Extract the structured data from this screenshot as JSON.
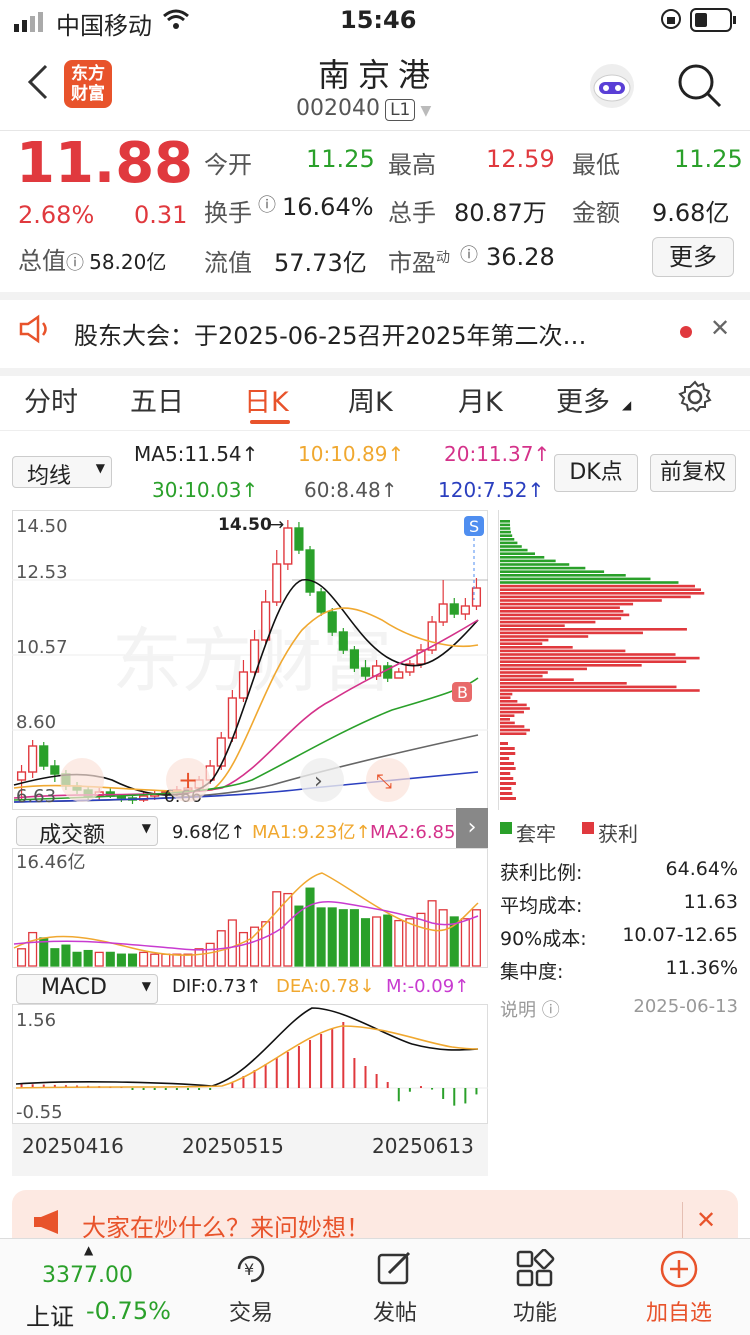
{
  "status": {
    "carrier": "中国移动",
    "time": "15:46"
  },
  "header": {
    "logo_line1": "东方",
    "logo_line2": "财富",
    "title": "南京港",
    "code": "002040",
    "level": "L1"
  },
  "quote": {
    "price": "11.88",
    "change_pct": "2.68%",
    "change": "0.31",
    "open_label": "今开",
    "open": "11.25",
    "high_label": "最高",
    "high": "12.59",
    "low_label": "最低",
    "low": "11.25",
    "turnover_label": "换手",
    "turnover": "16.64%",
    "volume_label": "总手",
    "volume": "80.87万",
    "amount_label": "金额",
    "amount": "9.68亿",
    "mcap_label": "总值",
    "mcap": "58.20亿",
    "float_label": "流值",
    "float": "57.73亿",
    "pe_label": "市盈",
    "pe_sup": "动",
    "pe": "36.28",
    "more": "更多"
  },
  "notice": {
    "text": "股东大会：于2025-06-25召开2025年第二次…"
  },
  "tabs": [
    "分时",
    "五日",
    "日K",
    "周K",
    "月K",
    "更多"
  ],
  "ma": {
    "dropdown": "均线",
    "ma5": "MA5:11.54",
    "ma10": "10:10.89",
    "ma20": "20:11.37",
    "ma30": "30:10.03",
    "ma60": "60:8.48",
    "ma120": "120:7.52",
    "dk": "DK点",
    "fq": "前复权"
  },
  "kline": {
    "y1": "14.50",
    "y2": "12.53",
    "y3": "10.57",
    "y4": "8.60",
    "y5": "6.63",
    "peak": "14.50",
    "low": "6.66",
    "b_label": "B",
    "s_label": "S"
  },
  "volume": {
    "dropdown": "成交额",
    "v": "9.68亿",
    "ma1": "MA1:9.23亿",
    "ma2": "MA2:6.85亿",
    "ymax": "16.46亿"
  },
  "macd": {
    "dropdown": "MACD",
    "dif": "DIF:0.73",
    "dea": "DEA:0.78",
    "m": "M:-0.09",
    "ymax": "1.56",
    "ymin": "-0.55"
  },
  "dates": [
    "20250416",
    "20250515",
    "20250613"
  ],
  "chips": {
    "legend_trapped": "套牢",
    "legend_profit": "获利",
    "rows": [
      {
        "k": "获利比例:",
        "v": "64.64%"
      },
      {
        "k": "平均成本:",
        "v": "11.63"
      },
      {
        "k": "90%成本:",
        "v": "10.07-12.65"
      },
      {
        "k": "集中度:",
        "v": "11.36%"
      }
    ],
    "note": "说明",
    "date": "2025-06-13"
  },
  "banner": {
    "text": "大家在炒什么？来问妙想！"
  },
  "bottom": {
    "index_value": "3377.00",
    "index_name": "上证",
    "index_change": "-0.75%",
    "items": [
      "交易",
      "发帖",
      "功能",
      "加自选"
    ]
  },
  "colors": {
    "up": "#e0393e",
    "down": "#2aa02a",
    "accent": "#e8532b"
  }
}
